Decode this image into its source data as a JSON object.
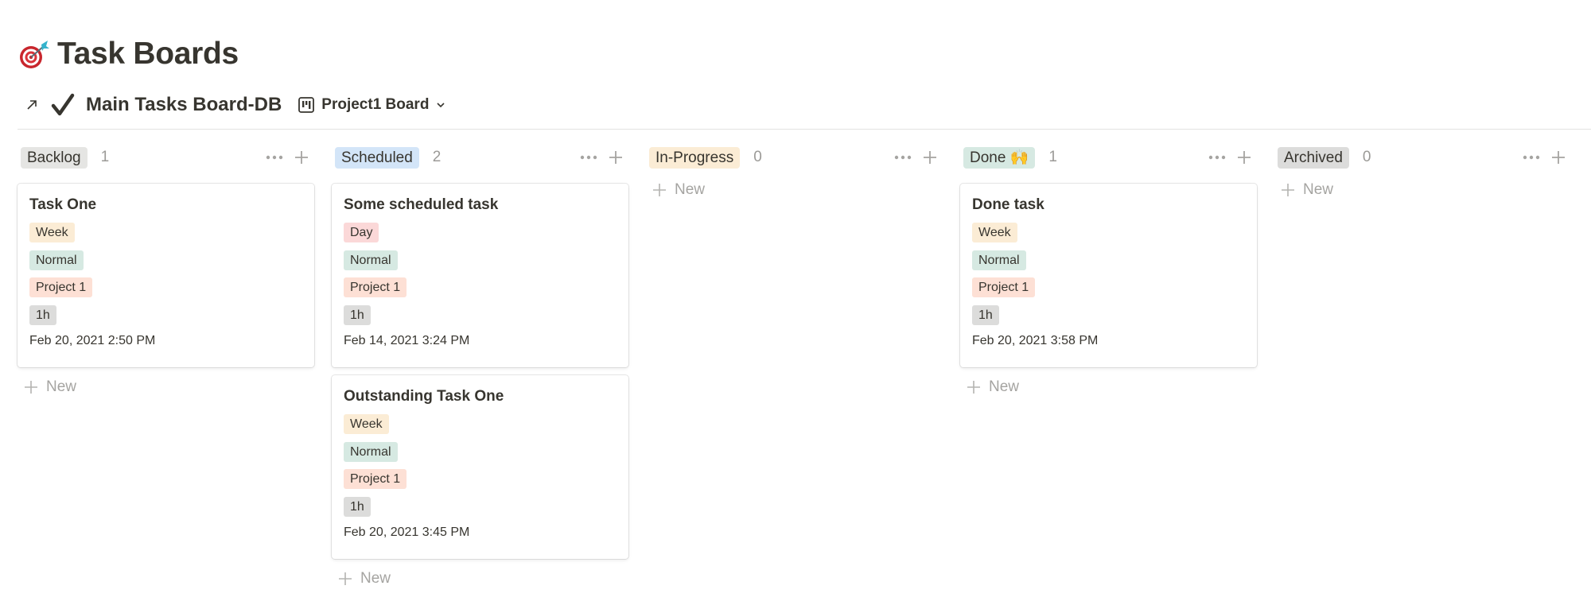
{
  "page": {
    "title": "Task Boards",
    "icon": "target-dart-icon"
  },
  "database": {
    "link_icon": "arrow-up-right-icon",
    "title_icon": "check-mark-icon",
    "title": "Main Tasks Board-DB",
    "view": {
      "icon": "board-view-icon",
      "label": "Project1 Board",
      "chevron": "chevron-down-icon"
    }
  },
  "tag_colors": {
    "Week": "#fbecd5",
    "Day": "#fbd8d8",
    "Normal": "#d6e9e2",
    "Project 1": "#fde0d5",
    "1h": "#dcdcdb"
  },
  "columns": [
    {
      "name": "Backlog",
      "count": "1",
      "color": "#e5e5e3",
      "cards": [
        {
          "title": "Task One",
          "tags": [
            "Week",
            "Normal",
            "Project 1",
            "1h"
          ],
          "date": "Feb 20, 2021 2:50 PM"
        }
      ],
      "new_label": "New"
    },
    {
      "name": "Scheduled",
      "count": "2",
      "color": "#d3e5f8",
      "cards": [
        {
          "title": "Some scheduled task",
          "tags": [
            "Day",
            "Normal",
            "Project 1",
            "1h"
          ],
          "date": "Feb 14, 2021 3:24 PM"
        },
        {
          "title": "Outstanding Task One",
          "tags": [
            "Week",
            "Normal",
            "Project 1",
            "1h"
          ],
          "date": "Feb 20, 2021 3:45 PM"
        }
      ],
      "new_label": "New"
    },
    {
      "name": "In-Progress",
      "count": "0",
      "color": "#fbecd5",
      "cards": [],
      "new_label": "New"
    },
    {
      "name": "Done 🙌",
      "count": "1",
      "color": "#d6e9e2",
      "cards": [
        {
          "title": "Done task",
          "tags": [
            "Week",
            "Normal",
            "Project 1",
            "1h"
          ],
          "date": "Feb 20, 2021 3:58 PM"
        }
      ],
      "new_label": "New"
    },
    {
      "name": "Archived",
      "count": "0",
      "color": "#dcdcdb",
      "cards": [],
      "new_label": "New"
    }
  ]
}
